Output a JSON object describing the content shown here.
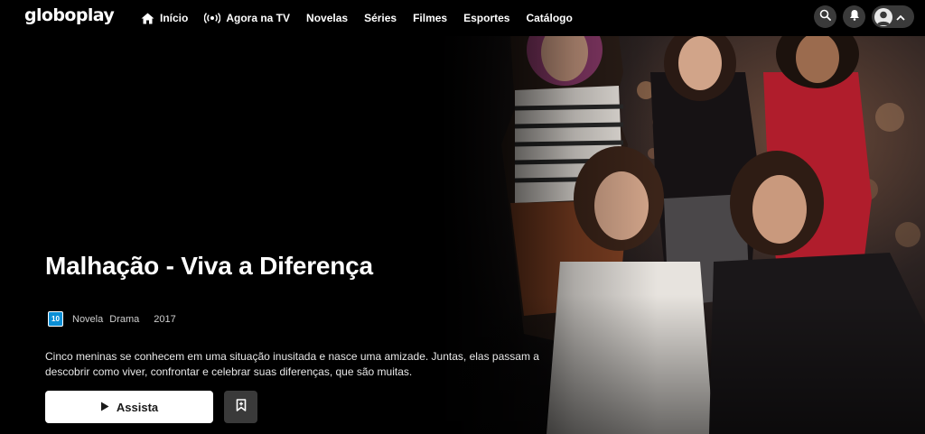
{
  "brand": {
    "logo_text": "globoplay"
  },
  "nav": {
    "items": [
      {
        "label": "Início",
        "icon": "home-icon"
      },
      {
        "label": "Agora na TV",
        "icon": "live-broadcast-icon"
      },
      {
        "label": "Novelas"
      },
      {
        "label": "Séries"
      },
      {
        "label": "Filmes"
      },
      {
        "label": "Esportes"
      },
      {
        "label": "Catálogo"
      }
    ],
    "right_icons": [
      "search-icon",
      "bell-icon",
      "avatar",
      "chevron-up-icon"
    ]
  },
  "hero": {
    "title": "Malhação - Viva a Diferença",
    "rating": "10",
    "rating_color": "#0c8fd6",
    "genre1": "Novela",
    "genre2": "Drama",
    "year": "2017",
    "description": "Cinco meninas se conhecem em uma situação inusitada e nasce uma amizade. Juntas, elas passam a descobrir como viver, confrontar e celebrar suas diferenças, que são muitas.",
    "play_label": "Assista",
    "save_icon": "bookmark-icon"
  }
}
